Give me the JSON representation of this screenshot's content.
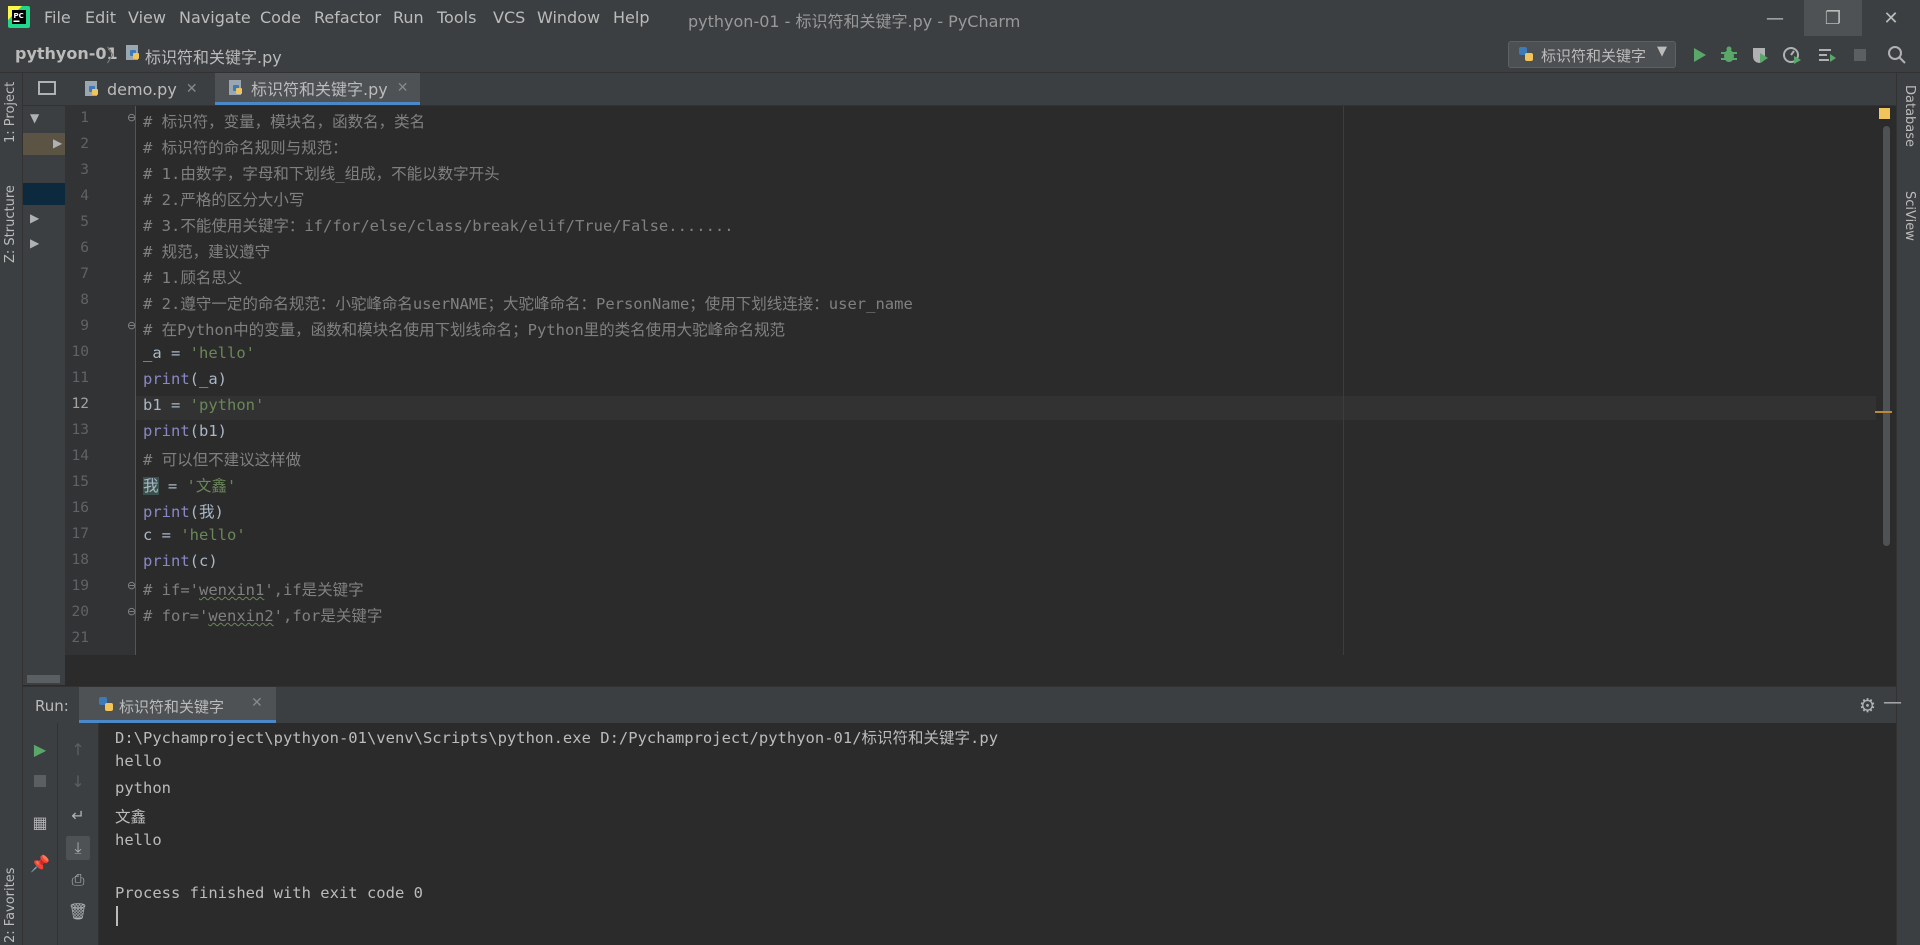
{
  "menu": [
    "File",
    "Edit",
    "View",
    "Navigate",
    "Code",
    "Refactor",
    "Run",
    "Tools",
    "VCS",
    "Window",
    "Help"
  ],
  "window_title": "pythyon-01 - 标识符和关键字.py - PyCharm",
  "breadcrumb": {
    "project": "pythyon-01",
    "file": "标识符和关键字.py"
  },
  "run_config": "标识符和关键字",
  "side_tools": {
    "project": "1: Project",
    "structure": "Z: Structure",
    "favorites": "2: Favorites",
    "database": "Database",
    "sciview": "SciView"
  },
  "tabs": [
    {
      "label": "demo.py",
      "active": false
    },
    {
      "label": "标识符和关键字.py",
      "active": true
    }
  ],
  "line_numbers": [
    "1",
    "2",
    "3",
    "4",
    "5",
    "6",
    "7",
    "8",
    "9",
    "10",
    "11",
    "12",
    "13",
    "14",
    "15",
    "16",
    "17",
    "18",
    "19",
    "20",
    "21"
  ],
  "current_line": "12",
  "code": {
    "l1": "# 标识符，变量，模块名，函数名，类名",
    "l2": "# 标识符的命名规则与规范：",
    "l3": "# 1.由数字，字母和下划线_组成，不能以数字开头",
    "l4": "# 2.严格的区分大小写",
    "l5": "# 3.不能使用关键字：if/for/else/class/break/elif/True/False.......",
    "l6": "# 规范，建议遵守",
    "l7": "# 1.顾名思义",
    "l8": "# 2.遵守一定的命名规范：小驼峰命名userNAME；大驼峰命名：PersonName；使用下划线连接：user_name",
    "l9": "# 在Python中的变量，函数和模块名使用下划线命名；Python里的类名使用大驼峰命名规范",
    "l10_a": "_a = ",
    "l10_b": "'hello'",
    "l11_a": "print",
    "l11_b": "(_a)",
    "l12_a": "b1 = ",
    "l12_b": "'python'",
    "l13_a": "print",
    "l13_b": "(b1)",
    "l14": "# 可以但不建议这样做",
    "l15_a": "我",
    "l15_b": " = ",
    "l15_c": "'文鑫'",
    "l16_a": "print",
    "l16_b": "(我)",
    "l17_a": "c = ",
    "l17_b": "'hello'",
    "l18_a": "print",
    "l18_b": "(c)",
    "l19_a": "# if='",
    "l19_b": "wenxin1",
    "l19_c": "',if是关键字",
    "l20_a": "# for='",
    "l20_b": "wenxin2",
    "l20_c": "',for是关键字"
  },
  "run_panel": {
    "label": "Run:",
    "tab": "标识符和关键字",
    "output": [
      "D:\\Pychamproject\\pythyon-01\\venv\\Scripts\\python.exe D:/Pychamproject/pythyon-01/标识符和关键字.py",
      "hello",
      "python",
      "文鑫",
      "hello",
      "",
      "Process finished with exit code 0"
    ]
  },
  "colors": {
    "accent": "#4a88c7",
    "run_green": "#59a869",
    "comment": "#808080",
    "string": "#6a8759",
    "builtin": "#8888c6"
  }
}
